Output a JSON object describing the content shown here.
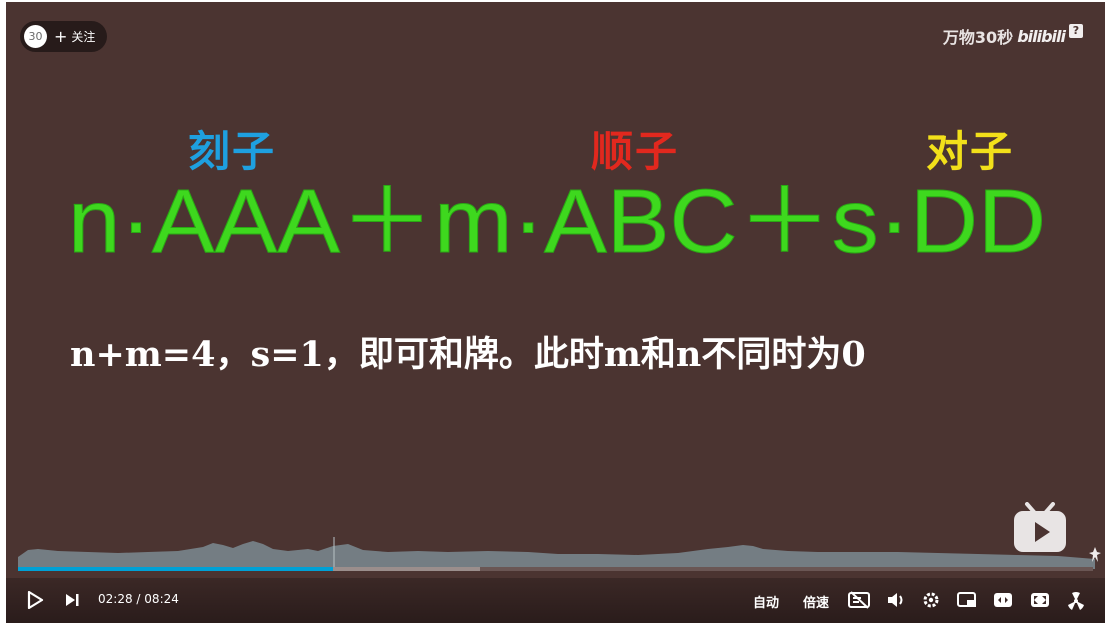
{
  "uploader": {
    "avatar_text": "30",
    "follow_label": "关注"
  },
  "watermark": {
    "channel_name": "万物30秒",
    "logo_text": "bilibili",
    "help_glyph": "?"
  },
  "video_frame": {
    "captions": {
      "kezi": "刻子",
      "shunzi": "顺子",
      "duizi": "对子"
    },
    "formula": "n·AAA＋m·ABC＋s·DD",
    "subtitle": "n+m=4，s=1，即可和牌。此时m和n不同时为0",
    "colors": {
      "background": "#4b3431",
      "formula": "#3ed81e",
      "kezi": "#1ea0e0",
      "shunzi": "#e2281e",
      "duizi": "#f2e01a"
    }
  },
  "progress": {
    "current_time": "02:28",
    "separator": "/",
    "total_time": "08:24",
    "played_fraction": 0.293,
    "buffered_fraction": 0.43
  },
  "controls": {
    "autoplay_label": "自动",
    "speed_label": "倍速",
    "icons": [
      "play-icon",
      "next-icon",
      "danmaku-off-icon",
      "volume-icon",
      "settings-icon",
      "pip-icon",
      "widescreen-icon",
      "fullscreen-icon",
      "radiation-icon"
    ]
  }
}
